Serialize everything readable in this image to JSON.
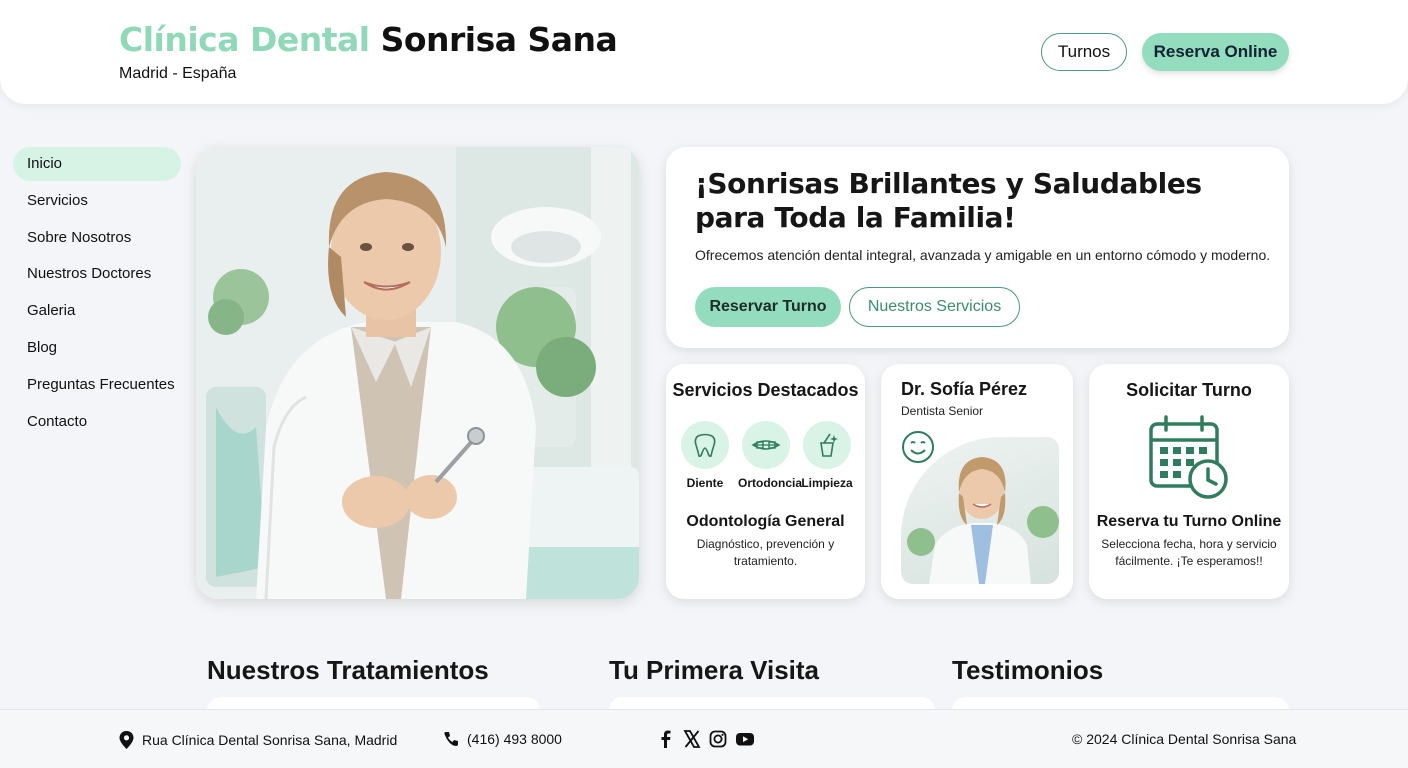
{
  "header": {
    "brand_part1": "Clínica Dental",
    "brand_part2": "Sonrisa Sana",
    "location": "Madrid - España",
    "turnos_label": "Turnos",
    "reserva_label": "Reserva Online"
  },
  "sidebar": {
    "items": [
      {
        "label": "Inicio"
      },
      {
        "label": "Servicios"
      },
      {
        "label": "Sobre Nosotros"
      },
      {
        "label": "Nuestros Doctores"
      },
      {
        "label": "Galeria"
      },
      {
        "label": "Blog"
      },
      {
        "label": "Preguntas Frecuentes"
      },
      {
        "label": "Contacto"
      }
    ]
  },
  "hero": {
    "title": "¡Sonrisas Brillantes y Saludables para Toda la Familia!",
    "subtitle": "Ofrecemos atención dental integral, avanzada y amigable en un entorno cómodo y moderno.",
    "primary_btn": "Reservar Turno",
    "secondary_btn": "Nuestros Servicios"
  },
  "services_card": {
    "title": "Servicios Destacados",
    "icons": [
      {
        "label": "Diente",
        "icon": "tooth-icon"
      },
      {
        "label": "Ortodoncia",
        "icon": "braces-icon"
      },
      {
        "label": "Limpieza",
        "icon": "toothbrush-icon"
      }
    ],
    "heading": "Odontología General",
    "text": "Diagnóstico, prevención y tratamiento."
  },
  "doctor_card": {
    "name": "Dr. Sofía Pérez",
    "role": "Dentista Senior"
  },
  "appointment_card": {
    "title": "Solicitar Turno",
    "heading": "Reserva tu Turno Online",
    "text": "Selecciona fecha, hora y servicio fácilmente. ¡Te esperamos!!"
  },
  "sections": {
    "treatments": "Nuestros Tratamientos",
    "first_visit": "Tu Primera Visita",
    "testimonials": "Testimonios"
  },
  "footer": {
    "address": "Rua Clínica Dental Sonrisa Sana, Madrid",
    "phone": "(416) 493 8000",
    "copyright": "© 2024 Clínica Dental Sonrisa Sana"
  },
  "colors": {
    "accent": "#93dcbd",
    "accent_light": "#d7f3e6",
    "accent_dark": "#3a8c6d"
  }
}
